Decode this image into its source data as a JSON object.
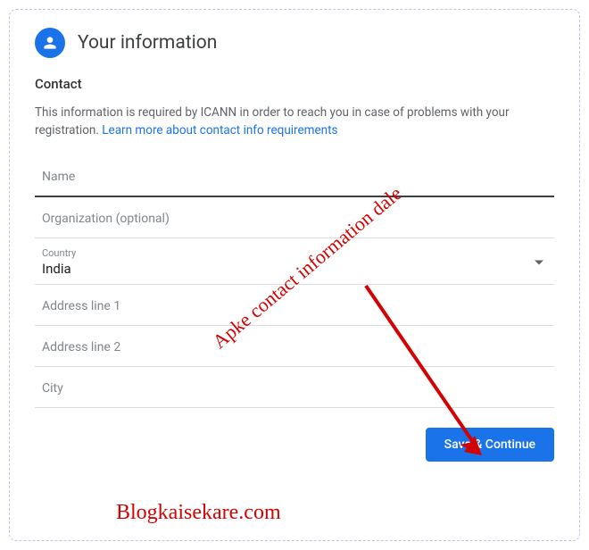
{
  "header": {
    "title": "Your information"
  },
  "section": {
    "heading": "Contact",
    "info_text": "This information is required by ICANN in order to reach you in case of problems with your registration. ",
    "link_text": "Learn more about contact info requirements"
  },
  "fields": {
    "name_label": "Name",
    "org_label": "Organization (optional)",
    "country_small": "Country",
    "country_value": "India",
    "addr1_label": "Address line 1",
    "addr2_label": "Address line 2",
    "city_label": "City"
  },
  "button": {
    "save_label": "Save & Continue"
  },
  "annotations": {
    "arrow_text": "Apke contact information dale",
    "brand": "Blogkaisekare.com"
  }
}
